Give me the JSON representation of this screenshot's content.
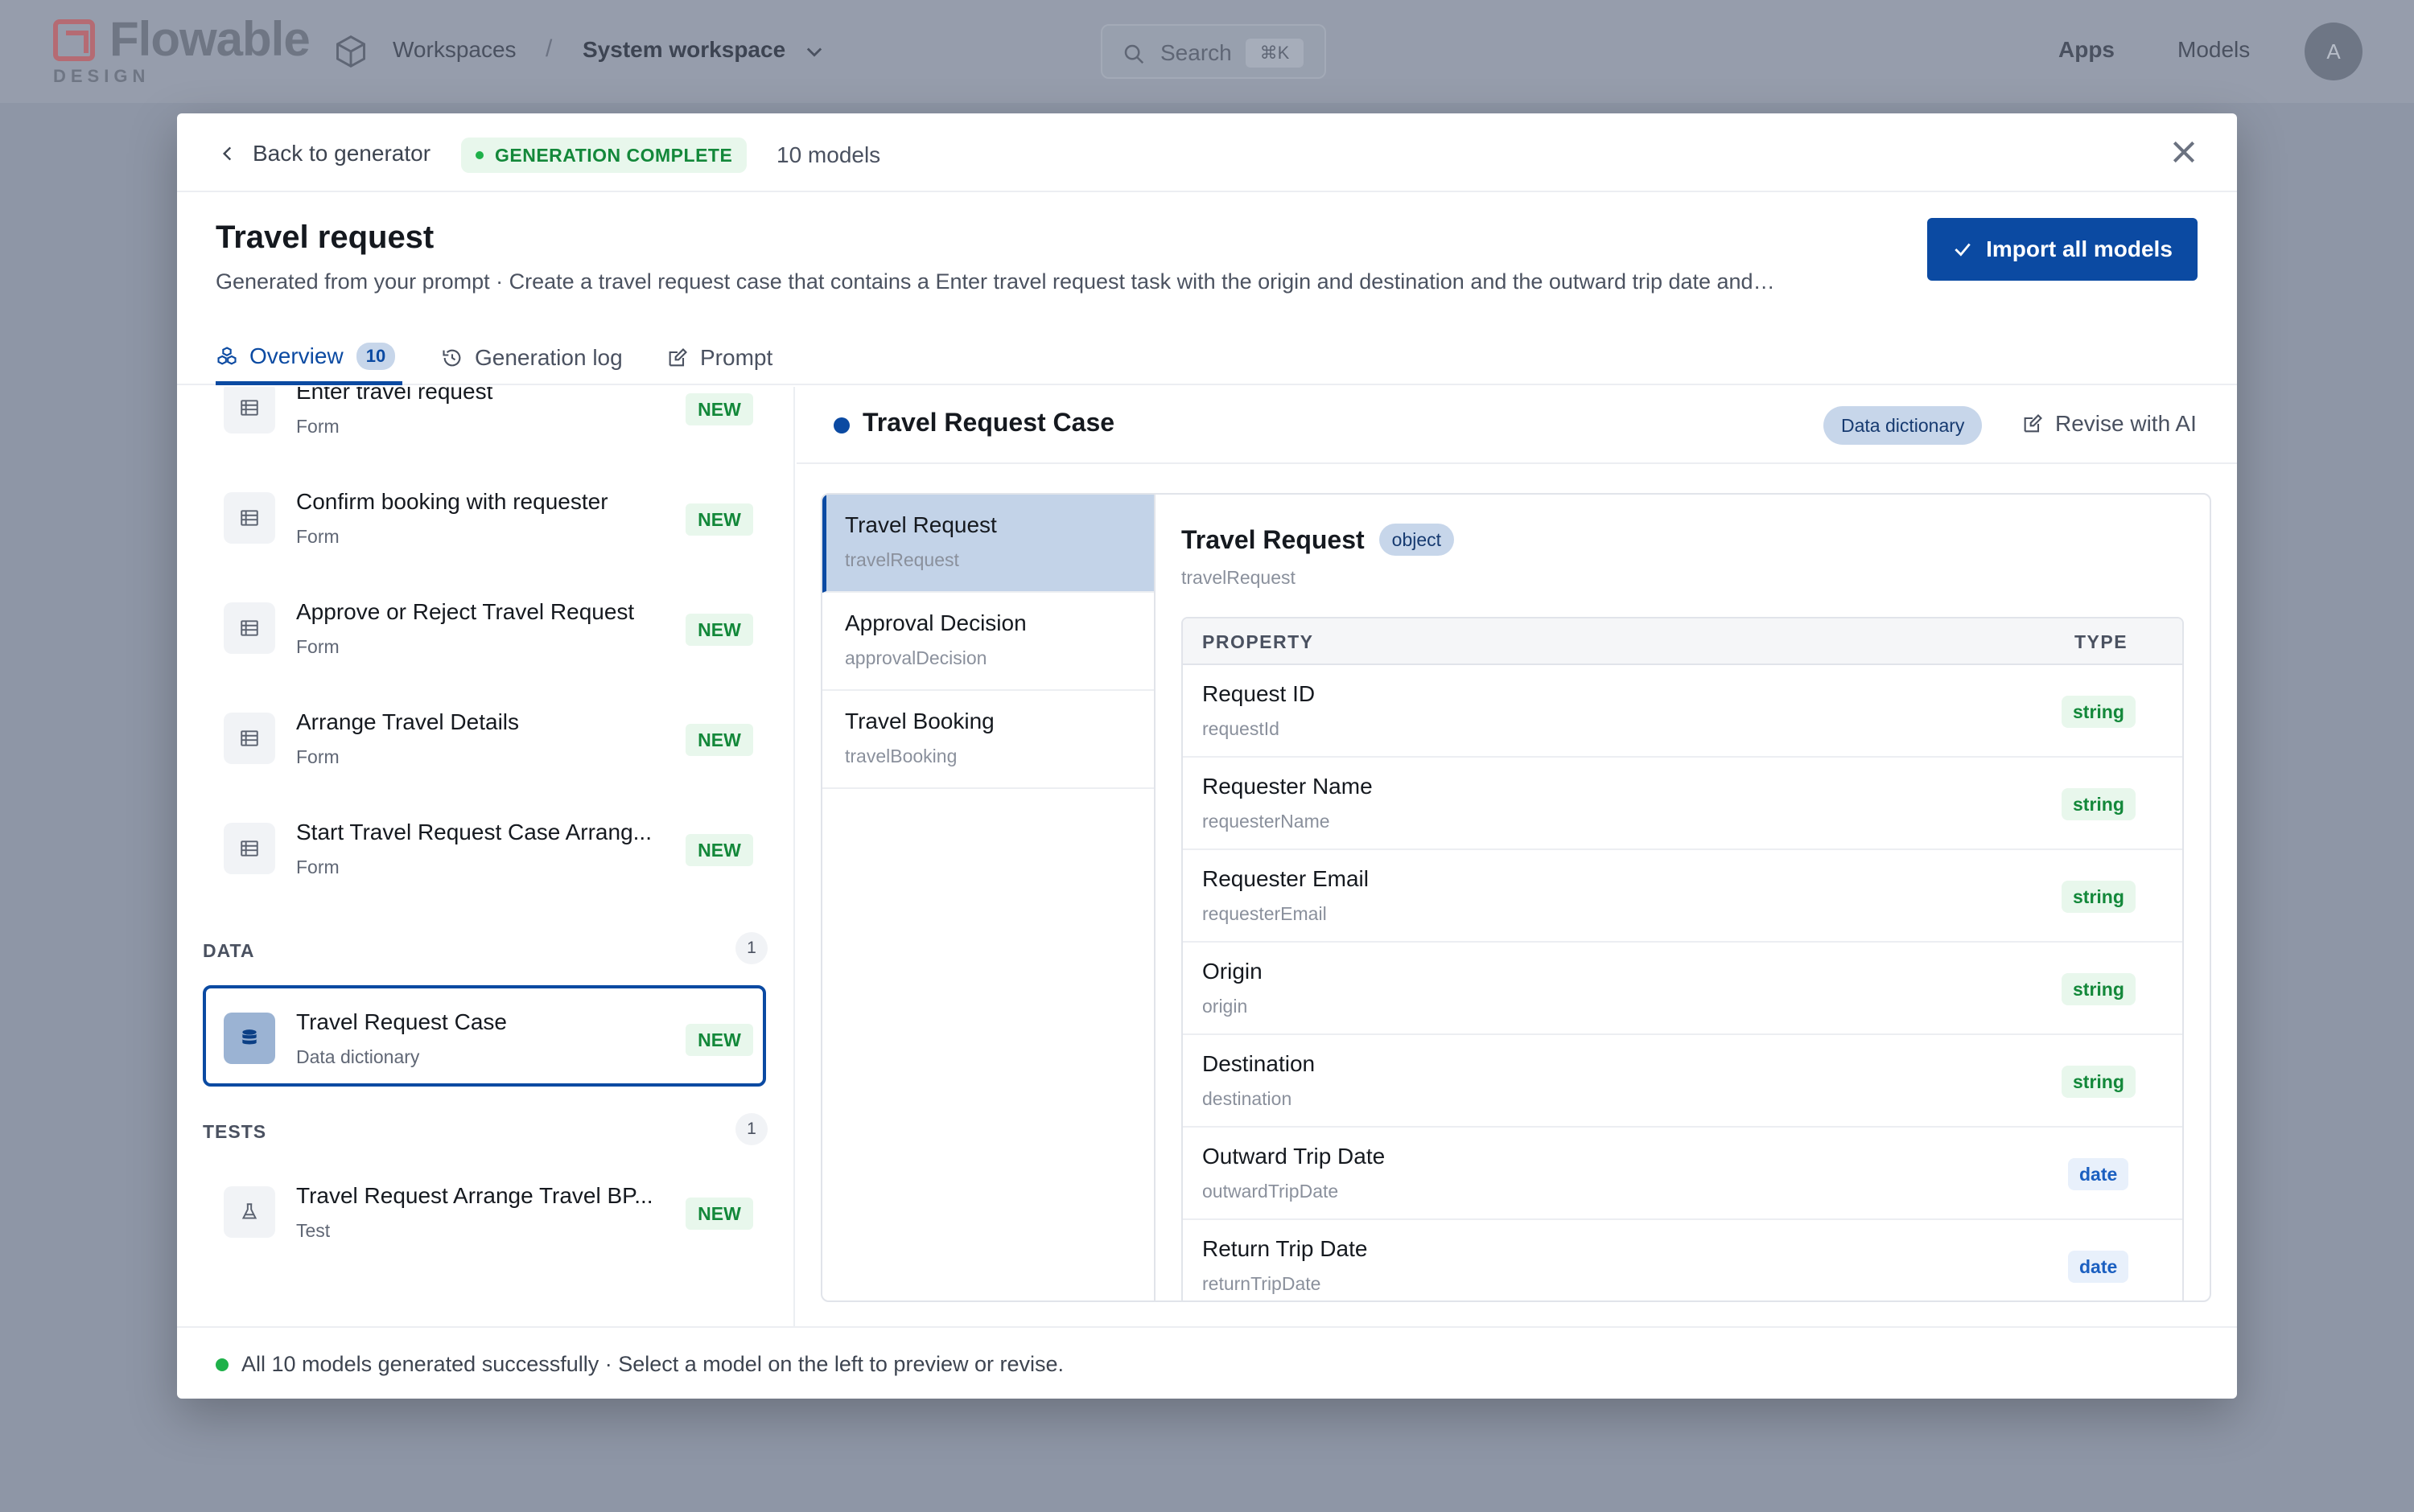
{
  "app": {
    "logo_text": "Flowable",
    "logo_sub": "DESIGN",
    "nav_workspaces": "Workspaces",
    "nav_separator": "/",
    "nav_current": "System workspace",
    "search_placeholder": "Search",
    "search_shortcut": "⌘K",
    "link_apps": "Apps",
    "link_models": "Models",
    "avatar_initial": "A"
  },
  "modal": {
    "back_label": "Back to generator",
    "status_badge": "GENERATION COMPLETE",
    "model_count": "10 models",
    "title": "Travel request",
    "subtitle": "Generated from your prompt · Create a travel request case that contains a Enter travel request task with the origin and destination and the outward trip date and…",
    "import_button": "Import all models",
    "tabs": [
      {
        "label": "Overview",
        "count": "10"
      },
      {
        "label": "Generation log"
      },
      {
        "label": "Prompt"
      }
    ],
    "forms": [
      {
        "name": "Enter travel request",
        "type": "Form",
        "badge": "NEW"
      },
      {
        "name": "Confirm booking with requester",
        "type": "Form",
        "badge": "NEW"
      },
      {
        "name": "Approve or Reject Travel Request",
        "type": "Form",
        "badge": "NEW"
      },
      {
        "name": "Arrange Travel Details",
        "type": "Form",
        "badge": "NEW"
      },
      {
        "name": "Start Travel Request Case Arrang...",
        "type": "Form",
        "badge": "NEW"
      }
    ],
    "data_section": {
      "label": "DATA",
      "count": "1"
    },
    "data_item": {
      "name": "Travel Request Case",
      "type": "Data dictionary",
      "badge": "NEW"
    },
    "tests_section": {
      "label": "TESTS",
      "count": "1"
    },
    "test_item": {
      "name": "Travel Request Arrange Travel BP...",
      "type": "Test",
      "badge": "NEW"
    },
    "detail": {
      "name": "Travel Request Case",
      "badge": "Data dictionary",
      "revise_label": "Revise with AI",
      "objects": [
        {
          "label": "Travel Request",
          "key": "travelRequest"
        },
        {
          "label": "Approval Decision",
          "key": "approvalDecision"
        },
        {
          "label": "Travel Booking",
          "key": "travelBooking"
        }
      ],
      "selected_object": {
        "label": "Travel Request",
        "type_badge": "object",
        "key": "travelRequest"
      },
      "table_headers": {
        "property": "PROPERTY",
        "type": "TYPE"
      },
      "properties": [
        {
          "label": "Request ID",
          "key": "requestId",
          "type": "string"
        },
        {
          "label": "Requester Name",
          "key": "requesterName",
          "type": "string"
        },
        {
          "label": "Requester Email",
          "key": "requesterEmail",
          "type": "string"
        },
        {
          "label": "Origin",
          "key": "origin",
          "type": "string"
        },
        {
          "label": "Destination",
          "key": "destination",
          "type": "string"
        },
        {
          "label": "Outward Trip Date",
          "key": "outwardTripDate",
          "type": "date"
        },
        {
          "label": "Return Trip Date",
          "key": "returnTripDate",
          "type": "date"
        }
      ]
    },
    "footer_text": "All 10 models generated successfully · Select a model on the left to preview or revise."
  },
  "colors": {
    "accent": "#0b4aa2",
    "success": "#13883a",
    "overlay": "#8e96a6"
  }
}
